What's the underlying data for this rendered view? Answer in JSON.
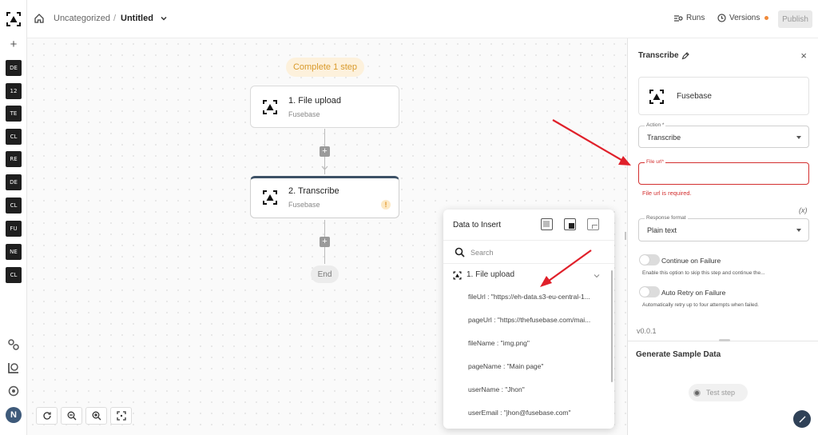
{
  "rail": {
    "add_label": "+",
    "items": [
      "DE",
      "12",
      "TE",
      "CL",
      "RE",
      "DE",
      "CL",
      "FU",
      "NE",
      "CL"
    ],
    "avatar_initial": "N"
  },
  "breadcrumb": {
    "folder": "Uncategorized",
    "separator": "/",
    "title": "Untitled"
  },
  "header": {
    "runs_label": "Runs",
    "versions_label": "Versions",
    "publish_label": "Publish"
  },
  "canvas": {
    "status_pill": "Complete 1 step",
    "nodes": [
      {
        "title": "1. File upload",
        "app": "Fusebase"
      },
      {
        "title": "2. Transcribe",
        "app": "Fusebase",
        "warning": "!"
      }
    ],
    "add_step": "+",
    "end_label": "End"
  },
  "data_popup": {
    "title": "Data to Insert",
    "search_placeholder": "Search",
    "group_label": "1. File upload",
    "fields": [
      "fileUrl : \"https://eh-data.s3-eu-central-1...",
      "pageUrl : \"https://thefusebase.com/mai...",
      "fileName : \"img.png\"",
      "pageName : \"Main page\"",
      "userName : \"Jhon\"",
      "userEmail : \"jhon@fusebase.com\""
    ]
  },
  "panel": {
    "title": "Transcribe",
    "close": "×",
    "app_name": "Fusebase",
    "action_label": "Action *",
    "action_value": "Transcribe",
    "file_url_label": "File url*",
    "file_url_value": "",
    "file_url_error": "File url is required.",
    "variable_badge": "(x)",
    "response_label": "Response format",
    "response_value": "Plain text",
    "continue_label": "Continue on Failure",
    "continue_desc": "Enable this option to skip this step and continue the...",
    "retry_label": "Auto Retry on Failure",
    "retry_desc": "Automatically retry up to four attempts when failed.",
    "version": "v0.0.1",
    "generate_title": "Generate Sample Data",
    "test_step": "Test step"
  },
  "colors": {
    "accent_dark": "#2f4157",
    "error": "#d32f2f",
    "pill_bg": "#fdf1dc",
    "pill_text": "#d99a2b",
    "arrow": "#e0202a"
  }
}
